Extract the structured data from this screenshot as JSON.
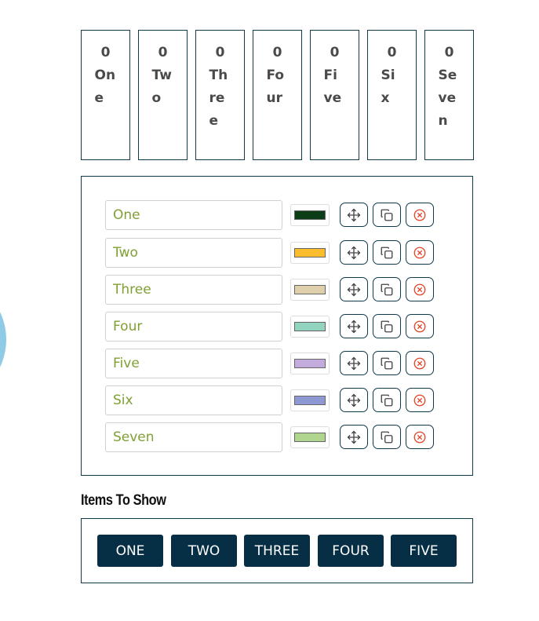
{
  "counters": [
    {
      "count": "0",
      "label": "One"
    },
    {
      "count": "0",
      "label": "Two"
    },
    {
      "count": "0",
      "label": "Three"
    },
    {
      "count": "0",
      "label": "Four"
    },
    {
      "count": "0",
      "label": "Five"
    },
    {
      "count": "0",
      "label": "Six"
    },
    {
      "count": "0",
      "label": "Seven"
    }
  ],
  "items": [
    {
      "name": "One",
      "color": "#0b3d17"
    },
    {
      "name": "Two",
      "color": "#fbbd2d"
    },
    {
      "name": "Three",
      "color": "#dfcfaa"
    },
    {
      "name": "Four",
      "color": "#92d4c0"
    },
    {
      "name": "Five",
      "color": "#c3abde"
    },
    {
      "name": "Six",
      "color": "#8e98d3"
    },
    {
      "name": "Seven",
      "color": "#afd58f"
    }
  ],
  "row_actions": {
    "move_icon": "move-arrows-icon",
    "copy_icon": "copy-icon",
    "remove_icon": "remove-circle-x-icon"
  },
  "colors": {
    "border": "#0e3a4a",
    "input_text": "#7fa033",
    "button_bg": "#062f46",
    "remove_icon": "#e0472b"
  },
  "items_to_show": {
    "title": "Items To Show",
    "buttons": [
      "ONE",
      "TWO",
      "THREE",
      "FOUR",
      "FIVE"
    ]
  }
}
